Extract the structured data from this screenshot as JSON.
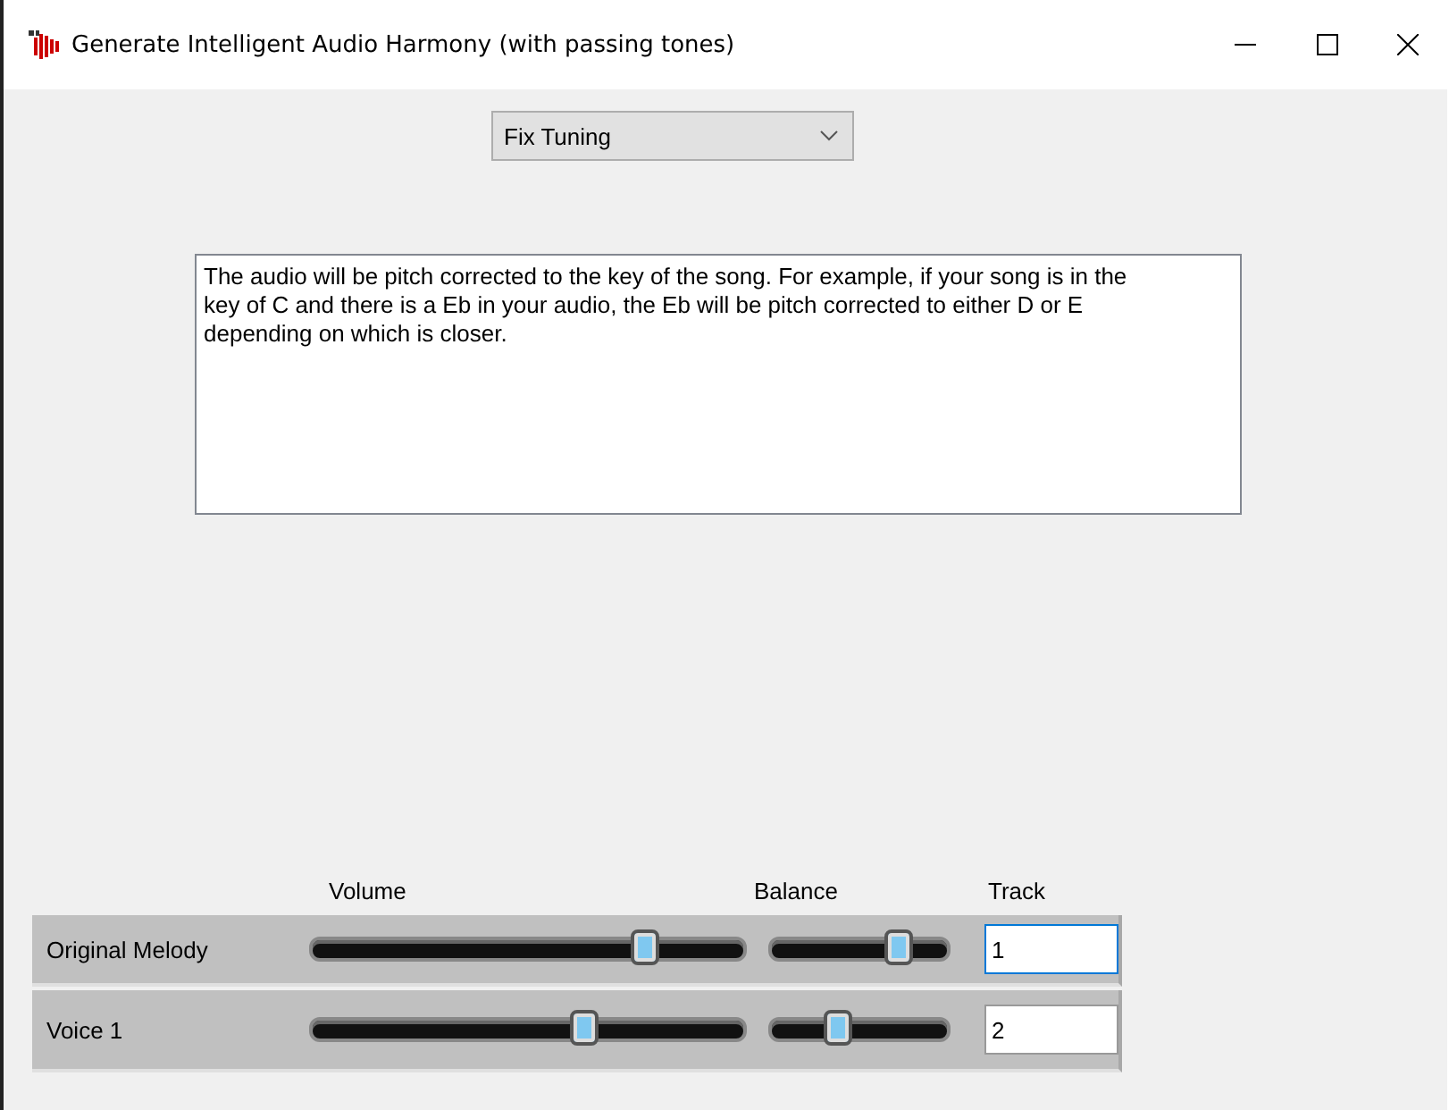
{
  "window": {
    "title": "Generate Intelligent Audio Harmony (with passing tones)"
  },
  "mode_dropdown": {
    "value": "Fix Tuning"
  },
  "description": "The audio will be pitch corrected to the key of the song. For example, if your song is in the key of C and there is a Eb in your audio, the Eb will be pitch corrected to either D or E depending on which is closer.",
  "mixer": {
    "columns": [
      "Volume",
      "Balance",
      "Track"
    ],
    "rows": [
      {
        "name": "Original Melody",
        "volume": {
          "level": 0.77
        },
        "balance": {
          "level": 0.72
        },
        "track": "1",
        "focused": true
      },
      {
        "name": "Voice 1",
        "volume": {
          "level": 0.63
        },
        "balance": {
          "level": 0.38
        },
        "track": "2",
        "focused": false
      }
    ]
  }
}
